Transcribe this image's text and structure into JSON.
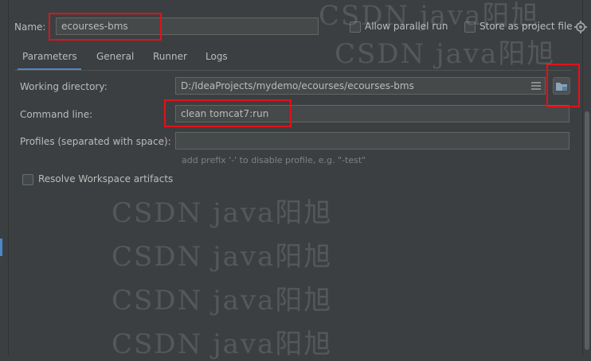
{
  "header": {
    "name_label": "Name:",
    "name_value": "ecourses-bms",
    "allow_parallel_label": "Allow parallel run",
    "store_project_label": "Store as project file"
  },
  "tabs": [
    {
      "label": "Parameters",
      "active": true
    },
    {
      "label": "General",
      "active": false
    },
    {
      "label": "Runner",
      "active": false
    },
    {
      "label": "Logs",
      "active": false
    }
  ],
  "form": {
    "working_directory_label": "Working directory:",
    "working_directory_value": "D:/IdeaProjects/mydemo/ecourses/ecourses-bms",
    "command_line_label": "Command line:",
    "command_line_value": "clean tomcat7:run",
    "profiles_label": "Profiles (separated with space):",
    "profiles_value": "",
    "profiles_hint": "add prefix '-' to disable profile, e.g. \"-test\"",
    "resolve_workspace_label": "Resolve Workspace artifacts"
  },
  "watermark": {
    "text": "CSDN java阳旭"
  },
  "colors": {
    "background": "#3c3f41",
    "field_bg": "#45494a",
    "text": "#bbbbbb",
    "accent": "#4a88c7",
    "highlight": "#e0121a"
  },
  "icons": {
    "gear": "gear-icon",
    "folder": "folder-icon",
    "list": "list-icon"
  }
}
